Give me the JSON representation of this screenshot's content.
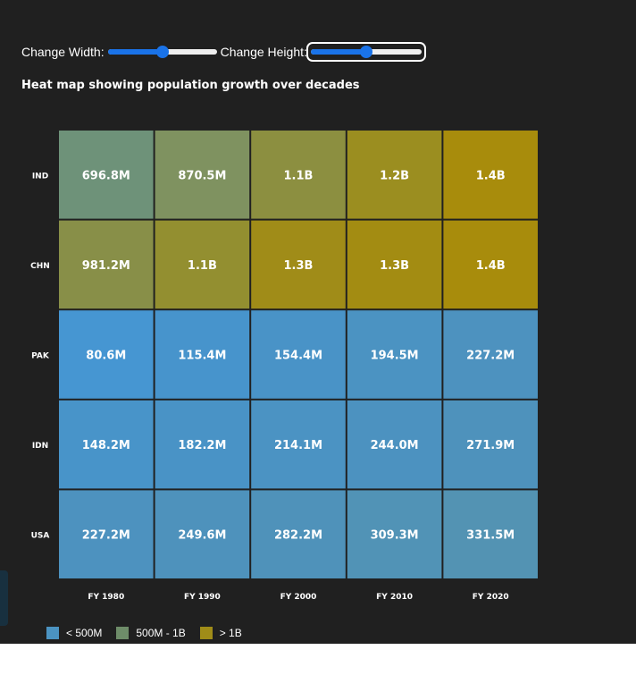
{
  "controls": {
    "width_label": "Change Width:",
    "height_label": "Change Height:",
    "width_slider": {
      "value": 0.5
    },
    "height_slider": {
      "value": 0.5
    }
  },
  "chart_data": {
    "type": "heatmap",
    "title": "Heat map showing population growth over decades",
    "x_categories": [
      "FY 1980",
      "FY 1990",
      "FY 2000",
      "FY 2010",
      "FY 2020"
    ],
    "y_categories": [
      "IND",
      "CHN",
      "PAK",
      "IDN",
      "USA"
    ],
    "values": [
      [
        696.8,
        870.5,
        1100,
        1200,
        1400
      ],
      [
        981.2,
        1100,
        1300,
        1300,
        1400
      ],
      [
        80.6,
        115.4,
        154.4,
        194.5,
        227.2
      ],
      [
        148.2,
        182.2,
        214.1,
        244.0,
        271.9
      ],
      [
        227.2,
        249.6,
        282.2,
        309.3,
        331.5
      ]
    ],
    "value_unit": "millions",
    "labels": [
      [
        "696.8M",
        "870.5M",
        "1.1B",
        "1.2B",
        "1.4B"
      ],
      [
        "981.2M",
        "1.1B",
        "1.3B",
        "1.3B",
        "1.4B"
      ],
      [
        "80.6M",
        "115.4M",
        "154.4M",
        "194.5M",
        "227.2M"
      ],
      [
        "148.2M",
        "182.2M",
        "214.1M",
        "244.0M",
        "271.9M"
      ],
      [
        "227.2M",
        "249.6M",
        "282.2M",
        "309.3M",
        "331.5M"
      ]
    ],
    "colors": [
      [
        "#6e9279",
        "#7f9260",
        "#8c8f40",
        "#9b8e20",
        "#a88c0c"
      ],
      [
        "#888f48",
        "#938f30",
        "#a08c18",
        "#a38c12",
        "#a88c0c"
      ],
      [
        "#4696d2",
        "#4794cc",
        "#4993c7",
        "#4b93c2",
        "#4d92bf"
      ],
      [
        "#4894c9",
        "#4993c6",
        "#4b93c3",
        "#4c92c0",
        "#4e92bc"
      ],
      [
        "#4d92bf",
        "#4e92bc",
        "#4f92ba",
        "#5193b6",
        "#5393b3"
      ]
    ],
    "legend": [
      {
        "label": "< 500M",
        "color": "#4b93c1"
      },
      {
        "label": "500M - 1B",
        "color": "#6e8c69"
      },
      {
        "label": "> 1B",
        "color": "#a08c18"
      }
    ],
    "grid_color": "#202020",
    "text_color": "#ffffff"
  }
}
